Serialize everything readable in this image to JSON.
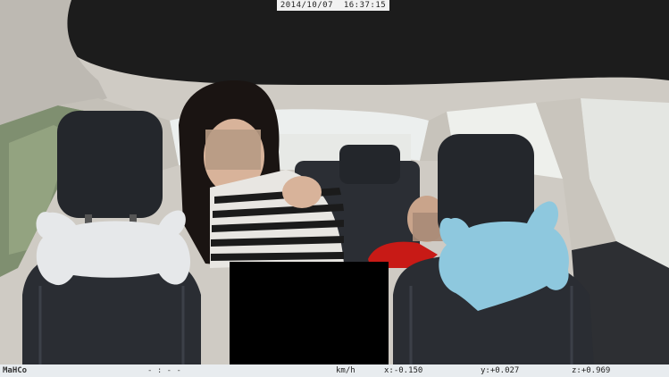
{
  "overlay": {
    "timestamp": "2014/10/07  16:37:15",
    "logo": "MaHCo",
    "speed": "- : - -",
    "speed_unit": "km/h",
    "gsensor_x": "x:-0.150",
    "gsensor_y": "y:+0.027",
    "gsensor_z": "z:+0.969"
  },
  "scene": {
    "description_icons": [
      "car-interior",
      "driver-seat",
      "passenger-seat",
      "headrest-pillow-white",
      "headrest-pillow-blue",
      "rear-seat",
      "woman-passenger",
      "child-passenger"
    ],
    "colors": {
      "roof": "#1c1c1c",
      "headliner": "#d9d6d0",
      "seat": "#2a2d33",
      "pillow_white": "#e6e8ea",
      "pillow_blue": "#8ec8de",
      "hair": "#1a1412",
      "skin": "#d8b39a",
      "shirt_stripe_dark": "#1b1b1b",
      "shirt_stripe_light": "#e8e6e2",
      "child_shirt": "#c81a16",
      "window": "#e9ecea",
      "foliage": "#8a9a78"
    }
  }
}
